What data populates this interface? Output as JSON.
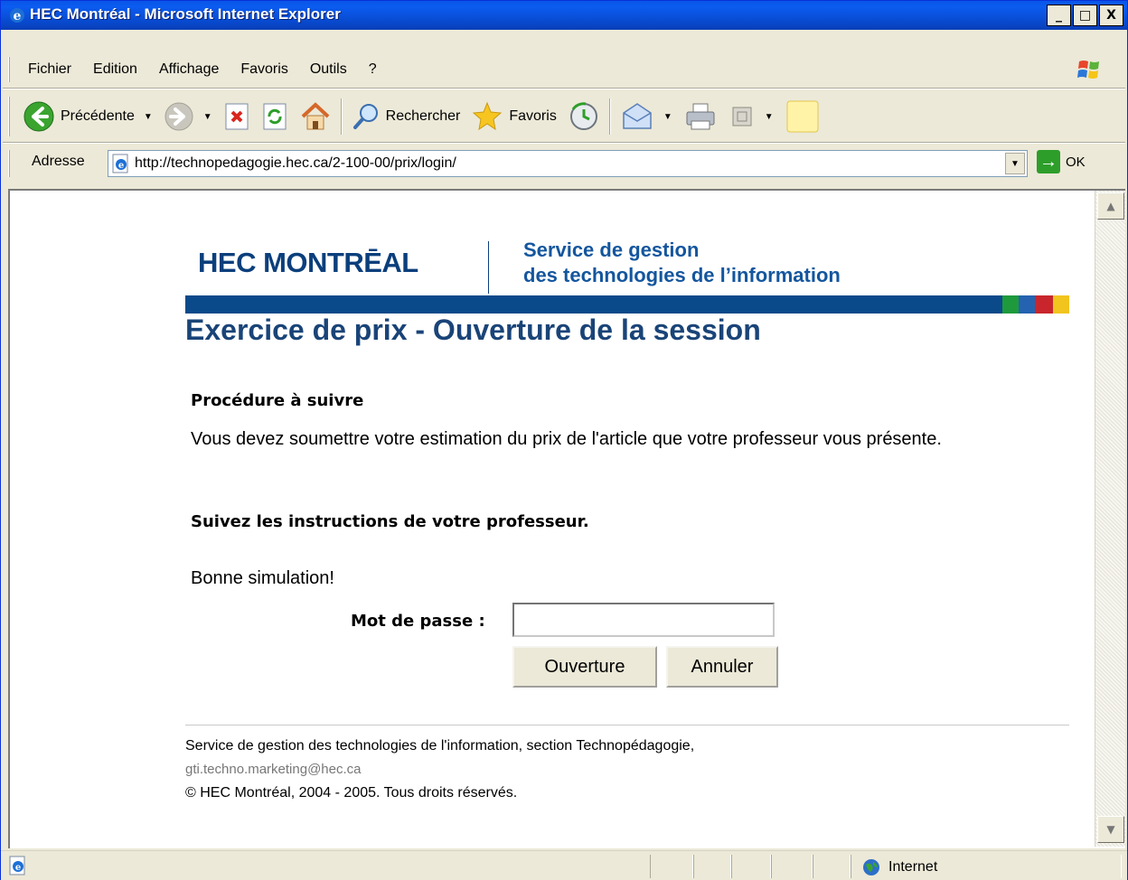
{
  "window": {
    "title": "HEC Montréal - Microsoft Internet Explorer",
    "min_label": "_",
    "max_label": "□",
    "close_label": "X"
  },
  "menu": {
    "items": [
      {
        "label": "Fichier"
      },
      {
        "label": "Edition"
      },
      {
        "label": "Affichage"
      },
      {
        "label": "Favoris"
      },
      {
        "label": "Outils"
      },
      {
        "label": "?"
      }
    ]
  },
  "toolbar": {
    "back_label": "Précédente",
    "search_label": "Rechercher",
    "favorites_label": "Favoris"
  },
  "address": {
    "label": "Adresse",
    "url": "http://technopedagogie.hec.ca/2-100-00/prix/login/",
    "go_label": "OK"
  },
  "page": {
    "logo_text": "HEC MONTRĒAL",
    "service_line1": "Service de gestion",
    "service_line2": "des technologies de l’information",
    "title": "Exercice de prix - Ouverture de la session",
    "procedure_heading": "Procédure à suivre",
    "procedure_text": "Vous devez soumettre votre estimation du prix de l'article que votre professeur vous présente.",
    "instructions": "Suivez les instructions de votre professeur.",
    "greeting": "Bonne simulation!",
    "password_label": "Mot de passe :",
    "password_value": "",
    "open_button": "Ouverture",
    "cancel_button": "Annuler",
    "footer_line1": "Service de gestion des technologies de l'information, section Technopédagogie,",
    "footer_email": "gti.techno.marketing@hec.ca",
    "footer_copyright": "© HEC Montréal, 2004 - 2005. Tous droits réservés."
  },
  "status": {
    "zone_label": "Internet"
  },
  "colors": {
    "brand_blue": "#0b4a8a",
    "bar_green": "#1e9a3c",
    "bar_blue": "#2563b0",
    "bar_red": "#c8262c",
    "bar_yellow": "#f2c41e"
  }
}
